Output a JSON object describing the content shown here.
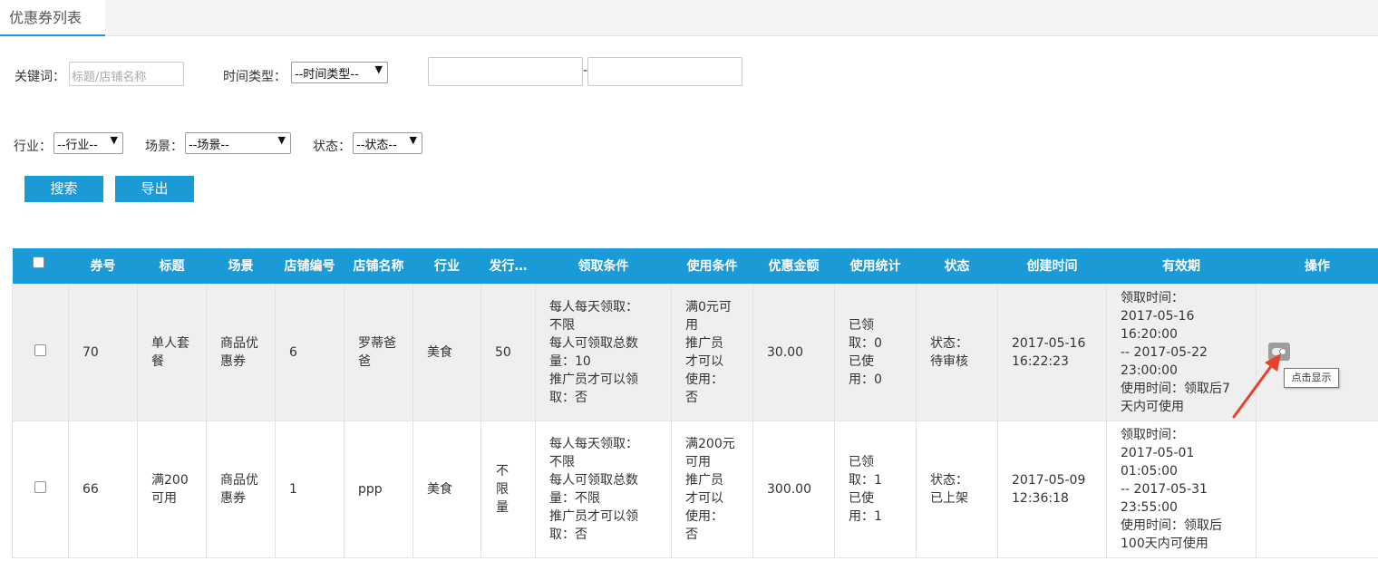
{
  "tab": {
    "title": "优惠券列表"
  },
  "filters": {
    "keyword_label": "关键词：",
    "keyword_placeholder": "标题/店铺名称",
    "time_type_label": "时间类型：",
    "time_type_value": "--时间类型--",
    "date_separator": "-",
    "industry_label": "行业：",
    "industry_value": "--行业--",
    "scene_label": "场景：",
    "scene_value": "--场景--",
    "status_label": "状态：",
    "status_value": "--状态--"
  },
  "buttons": {
    "search": "搜索",
    "export": "导出"
  },
  "table": {
    "columns": [
      "券号",
      "标题",
      "场景",
      "店铺编号",
      "店铺名称",
      "行业",
      "发行…",
      "领取条件",
      "使用条件",
      "优惠金额",
      "使用统计",
      "状态",
      "创建时间",
      "有效期",
      "操作"
    ],
    "rows": [
      {
        "id": "70",
        "title": "单人套餐",
        "scene": "商品优惠券",
        "shop_no": "6",
        "shop_name": "罗蒂爸爸",
        "industry": "美食",
        "issue": "50",
        "receive_cond": "每人每天领取：不限\n每人可领取总数量：10\n推广员才可以领取：否",
        "use_cond": "满0元可用\n推广员才可以使用：否",
        "amount": "30.00",
        "stats": "已领取：0\n已使用：0",
        "status": "状态：待审核",
        "created": "2017-05-16 16:22:23",
        "validity": "领取时间：\n2017-05-16 16:20:00 -- 2017-05-22 23:00:00\n使用时间：领取后7天内可使用"
      },
      {
        "id": "66",
        "title": "满200可用",
        "scene": "商品优惠券",
        "shop_no": "1",
        "shop_name": "ppp",
        "industry": "美食",
        "issue": "不限量",
        "receive_cond": "每人每天领取：不限\n每人可领取总数量：不限\n推广员才可以领取：否",
        "use_cond": "满200元可用\n推广员才可以使用：否",
        "amount": "300.00",
        "stats": "已领取：1\n已使用：1",
        "status": "状态：已上架",
        "created": "2017-05-09 12:36:18",
        "validity": "领取时间：\n2017-05-01 01:05:00 -- 2017-05-31 23:55:00\n使用时间：领取后100天内可使用"
      }
    ]
  },
  "tooltip": {
    "text": "点击显示"
  },
  "colors": {
    "accent": "#1a9ad6",
    "annotation_arrow": "#e8412d"
  }
}
